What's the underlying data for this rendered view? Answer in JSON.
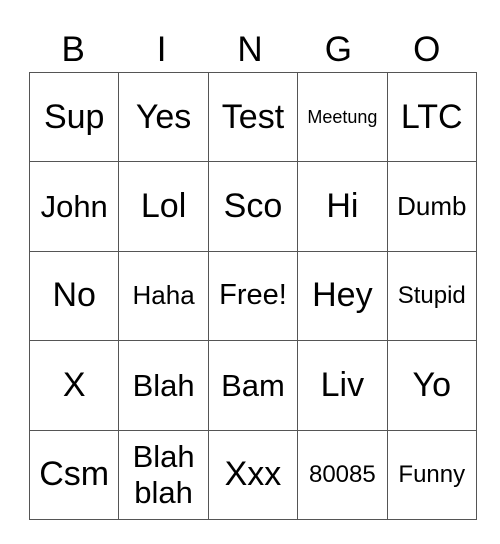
{
  "header": [
    "B",
    "I",
    "N",
    "G",
    "O"
  ],
  "rows": [
    [
      "Sup",
      "Yes",
      "Test",
      "Meetung",
      "LTC"
    ],
    [
      "John",
      "Lol",
      "Sco",
      "Hi",
      "Dumb"
    ],
    [
      "No",
      "Haha",
      "Free!",
      "Hey",
      "Stupid"
    ],
    [
      "X",
      "Blah",
      "Bam",
      "Liv",
      "Yo"
    ],
    [
      "Csm",
      "Blah blah",
      "Xxx",
      "80085",
      "Funny"
    ]
  ]
}
